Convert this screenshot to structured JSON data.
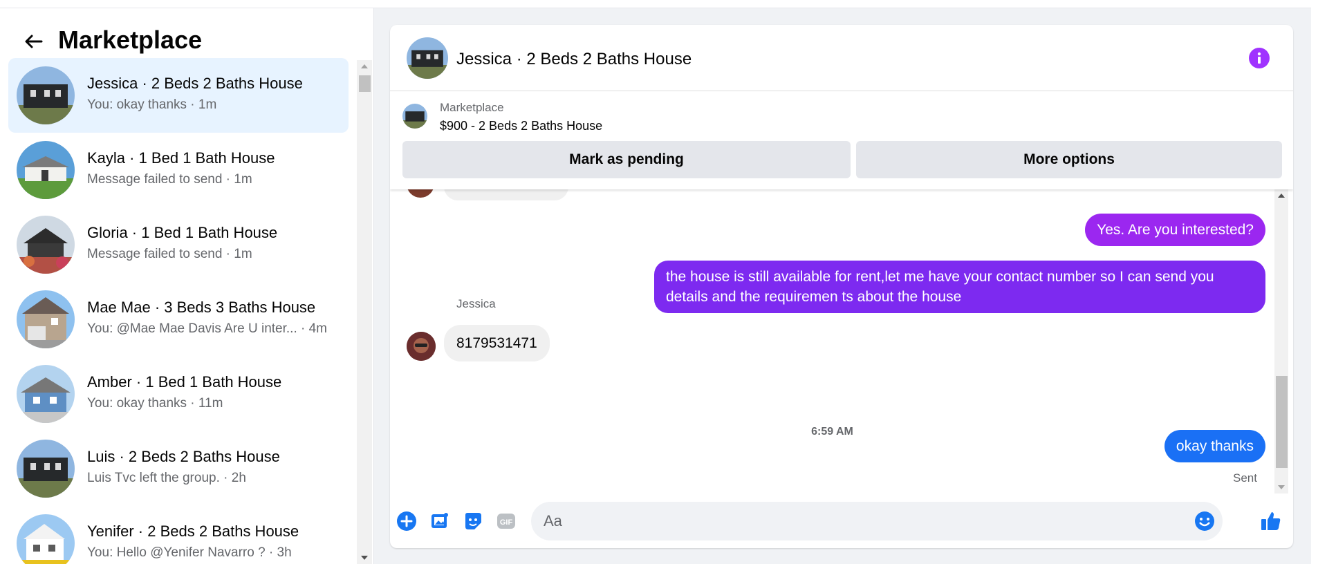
{
  "sidebar": {
    "title": "Marketplace",
    "conversations": [
      {
        "title": "Jessica · 2 Beds 2 Baths House",
        "subtitle": "You: okay thanks · 1m"
      },
      {
        "title": "Kayla · 1 Bed 1 Bath House",
        "subtitle": "Message failed to send · 1m"
      },
      {
        "title": "Gloria · 1 Bed 1 Bath House",
        "subtitle": "Message failed to send · 1m"
      },
      {
        "title": "Mae Mae · 3 Beds 3 Baths House",
        "subtitle": "You: @Mae Mae Davis Are U inter...  · 4m"
      },
      {
        "title": "Amber · 1 Bed 1 Bath House",
        "subtitle": "You: okay thanks · 11m"
      },
      {
        "title": "Luis · 2 Beds 2 Baths House",
        "subtitle": "Luis Tvc left the group. · 2h"
      },
      {
        "title": "Yenifer · 2 Beds 2 Baths House",
        "subtitle": "You: Hello @Yenifer Navarro ? · 3h"
      }
    ]
  },
  "chat": {
    "title": "Jessica · 2 Beds 2 Baths House",
    "listing": {
      "kind": "Marketplace",
      "title": "$900 - 2 Beds 2 Baths House",
      "pending_label": "Mark as pending",
      "more_label": "More options"
    },
    "messages": {
      "out_1": "Yes. Are you interested?",
      "out_2": "the house is still available for rent,let me have your contact number so I can send you details and the requiremen ts about the house",
      "in_sender": "Jessica",
      "in_1": "8179531471",
      "timestamp": "6:59 AM",
      "out_3": "okay thanks",
      "status": "Sent"
    },
    "composer": {
      "placeholder": "Aa"
    }
  },
  "colors": {
    "accent": "#1877f2",
    "purple": "#a033ff",
    "active_row": "#e7f3ff"
  }
}
